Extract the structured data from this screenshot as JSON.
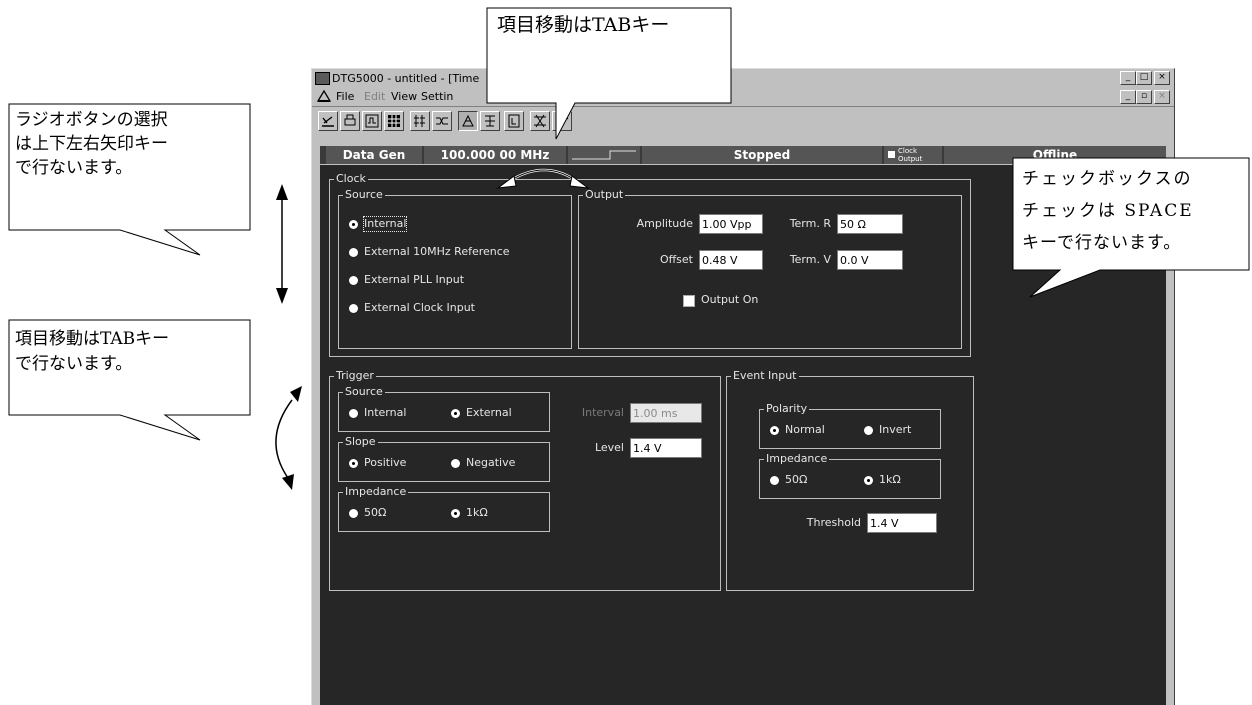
{
  "window": {
    "title": "DTG5000 - untitled - [Time",
    "min_label": "_",
    "max_label": "□",
    "close_label": "×",
    "child_restore_label": "▫"
  },
  "menu": {
    "file": "File",
    "edit": "Edit",
    "view": "View",
    "settings": "Settin"
  },
  "status": {
    "mode": "Data Gen",
    "frequency": "100.000 00 MHz",
    "run_state": "Stopped",
    "clock_output_line1": "Clock",
    "clock_output_line2": "Output",
    "connection": "Offline"
  },
  "clock": {
    "group": "Clock",
    "source_group": "Source",
    "sources": [
      "Internal",
      "External 10MHz Reference",
      "External PLL Input",
      "External Clock Input"
    ],
    "selected_source": 0,
    "output_group": "Output",
    "amplitude_label": "Amplitude",
    "amplitude_value": "1.00 Vpp",
    "offset_label": "Offset",
    "offset_value": "0.48 V",
    "term_r_label": "Term. R",
    "term_r_value": "50 Ω",
    "term_v_label": "Term. V",
    "term_v_value": "0.0 V",
    "output_on_label": "Output On"
  },
  "trigger": {
    "group": "Trigger",
    "source_group": "Source",
    "source_internal": "Internal",
    "source_external": "External",
    "slope_group": "Slope",
    "slope_positive": "Positive",
    "slope_negative": "Negative",
    "impedance_group": "Impedance",
    "imp_50": "50Ω",
    "imp_1k": "1kΩ",
    "interval_label": "Interval",
    "interval_value": "1.00 ms",
    "level_label": "Level",
    "level_value": "1.4 V"
  },
  "event": {
    "group": "Event Input",
    "polarity_group": "Polarity",
    "polarity_normal": "Normal",
    "polarity_invert": "Invert",
    "impedance_group": "Impedance",
    "imp_50": "50Ω",
    "imp_1k": "1kΩ",
    "threshold_label": "Threshold",
    "threshold_value": "1.4 V"
  },
  "callouts": {
    "top": "項目移動はTABキー",
    "radio_line1": "ラジオボタンの選択",
    "radio_line2": "は上下左右矢印キー",
    "radio_line3": "で行ないます。",
    "tab_line1": "項目移動はTABキー",
    "tab_line2": "で行ないます。",
    "check_line1": "チェックボックスの",
    "check_line2": "チェックは SPACE",
    "check_line3": "キーで行ないます。"
  },
  "colors": {
    "panel": "#262626",
    "window_face": "#c0c0c0",
    "status_cell": "#555555"
  }
}
